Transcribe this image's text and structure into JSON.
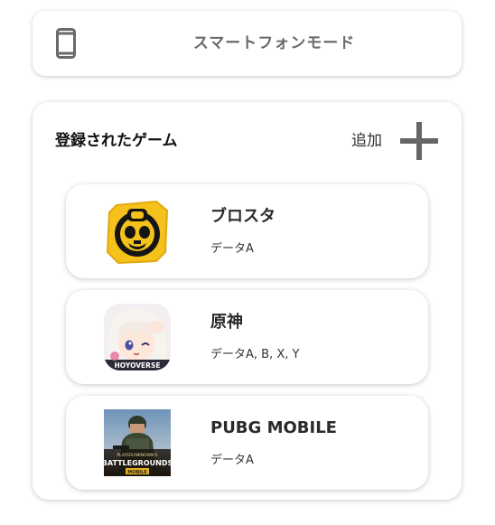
{
  "mode": {
    "label": "スマートフォンモード",
    "icon": "smartphone-icon"
  },
  "games_panel": {
    "title": "登録されたゲーム",
    "add_label": "追加",
    "add_icon": "plus-icon"
  },
  "games": [
    {
      "name": "ブロスタ",
      "data": "データA",
      "icon": "brawl-stars-icon"
    },
    {
      "name": "原神",
      "data": "データA, B, X, Y",
      "icon": "genshin-impact-icon",
      "icon_text": "HOYOVERSE"
    },
    {
      "name": "PUBG MOBILE",
      "data": "データA",
      "icon": "pubg-mobile-icon",
      "icon_text": [
        "PLAYERUNKNOWN'S",
        "BATTLEGROUNDS",
        "MOBILE"
      ]
    }
  ],
  "colors": {
    "icon_gray": "#666666",
    "brawl_yellow": "#f5c21b",
    "pubg_sky": "#7c9fc0"
  }
}
